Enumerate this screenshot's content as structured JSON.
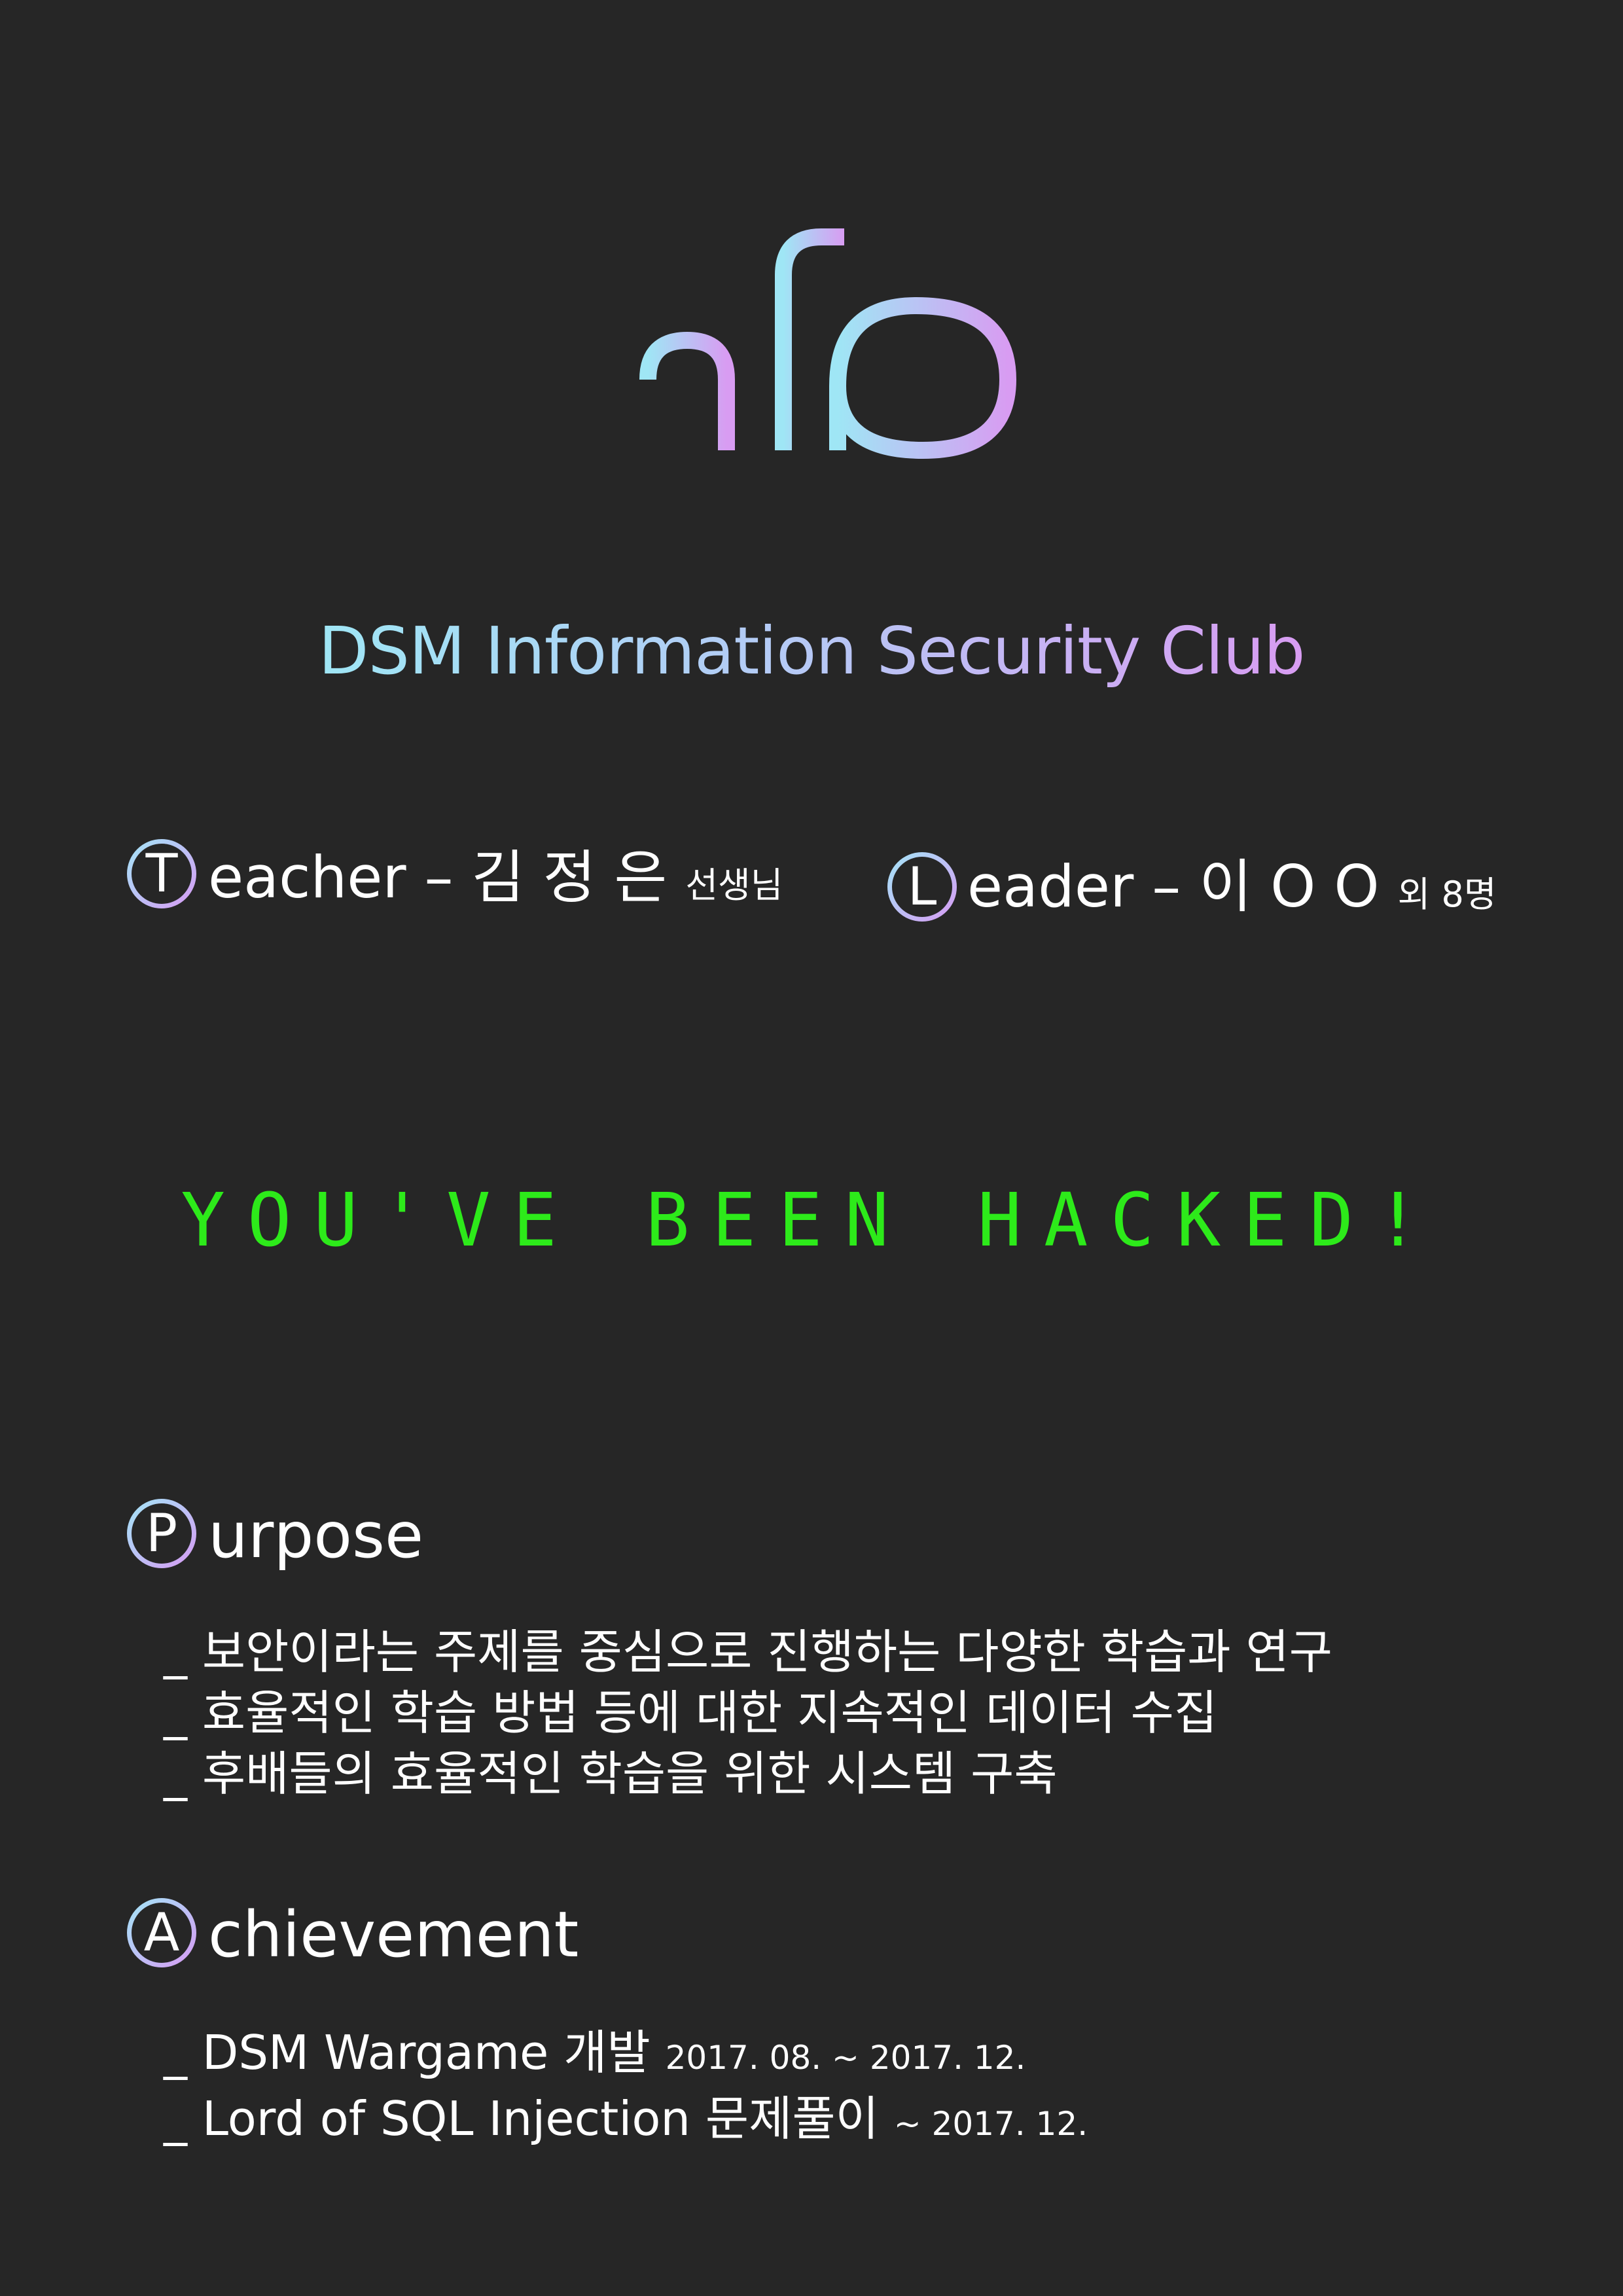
{
  "logo": {
    "text": "Info",
    "gradient": [
      "#9fe6f5",
      "#d89cf2"
    ]
  },
  "subtitle": "DSM Information Security Club",
  "teacher": {
    "initial": "T",
    "rest": "eacher",
    "dash": "–",
    "name": "김 정 은",
    "suffix": "선생님"
  },
  "leader": {
    "initial": "L",
    "rest": "eader",
    "dash": "–",
    "name": "이 O O",
    "suffix": "외 8명"
  },
  "hacked": "YOU'VE BEEN HACKED!",
  "purpose": {
    "initial": "P",
    "rest": "urpose",
    "items": [
      "_ 보안이라는 주제를 중심으로 진행하는 다양한 학습과 연구",
      "_ 효율적인 학습 방법 등에 대한 지속적인 데이터 수집",
      "_ 후배들의 효율적인 학습을 위한 시스템 구축"
    ]
  },
  "achievement": {
    "initial": "A",
    "rest": "chievement",
    "items": [
      {
        "text": "_ DSM Wargame 개발",
        "date": "2017. 08. ~ 2017. 12."
      },
      {
        "text": "_ Lord of SQL Injection 문제풀이",
        "date": "~ 2017. 12."
      }
    ]
  },
  "colors": {
    "background": "#262626",
    "hacked": "#2dea1a",
    "gradient_start": "#9fe6f5",
    "gradient_end": "#d89cf2"
  }
}
